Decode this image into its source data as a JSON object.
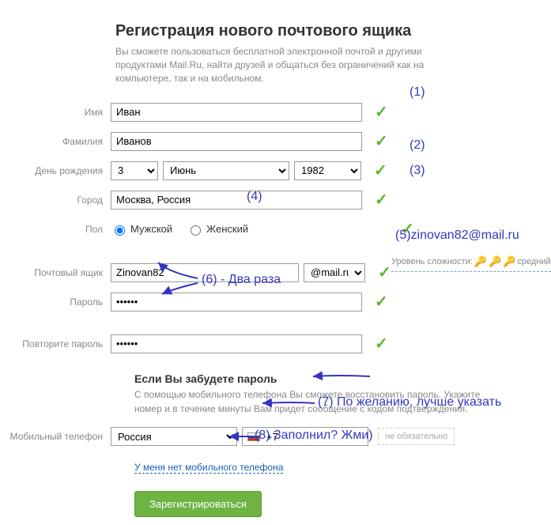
{
  "header": {
    "title": "Регистрация нового почтового ящика",
    "intro": "Вы сможете пользоваться бесплатной электронной почтой и другими продуктами Mail.Ru, найти друзей и общаться без ограничений как на компьютере, так и на мобильном."
  },
  "labels": {
    "firstname": "Имя",
    "lastname": "Фамилия",
    "birthday": "День рождения",
    "city": "Город",
    "gender": "Пол",
    "mailbox": "Почтовый ящик",
    "password": "Пароль",
    "password_confirm": "Повторите пароль",
    "phone": "Мобильный телефон"
  },
  "values": {
    "firstname": "Иван",
    "lastname": "Иванов",
    "day": "3",
    "month": "Июнь",
    "year": "1982",
    "city": "Москва, Россия",
    "mailbox": "Zinovan82",
    "domain": "@mail.ru",
    "password": "••••••",
    "password_confirm": "••••••",
    "country": "Россия",
    "phone_code": "+7"
  },
  "gender": {
    "male": "Мужской",
    "female": "Женский"
  },
  "forgot": {
    "title": "Если Вы забудете пароль",
    "text": "С помощью мобильного телефона Вы сможете восстановить пароль. Укажите номер и в течение минуты Вам придет сообщение с кодом подтверждения."
  },
  "optional_badge": "не обязательно",
  "no_phone_link": "У меня нет мобильного телефона",
  "submit": "Зарегистрироваться",
  "strength": {
    "label": "Уровень сложности:",
    "value": "средний"
  },
  "annotations": {
    "a1": "(1)",
    "a2": "(2)",
    "a3": "(3)",
    "a4": "(4)",
    "a5": "(5)zinovan82@mail.ru",
    "a6": "(6) - Два раза",
    "a7": "(7) По желанию, лучше указать",
    "a8": "(8) Заполнил? Жми)"
  }
}
